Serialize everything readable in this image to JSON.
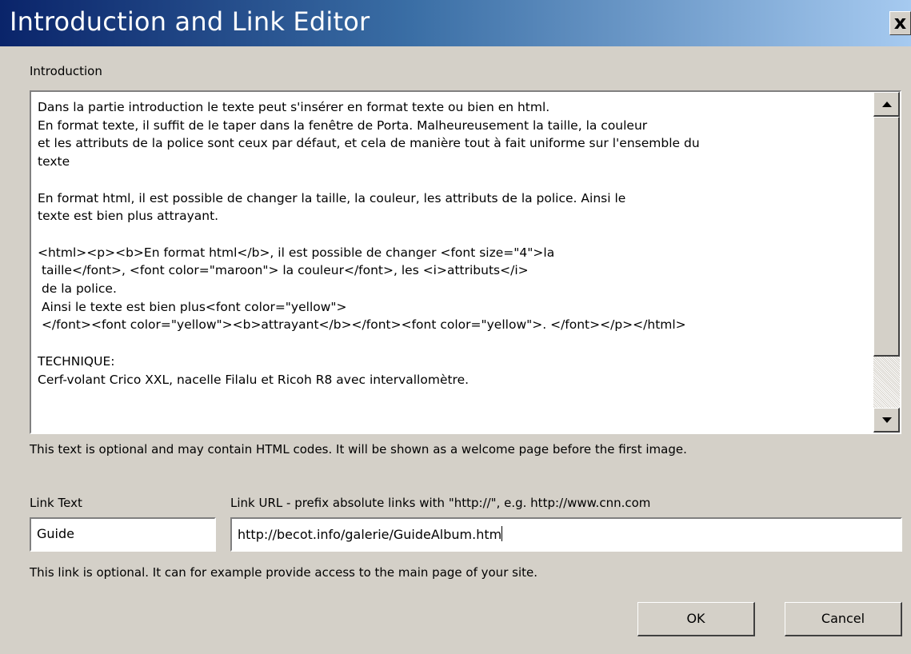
{
  "window": {
    "title": "Introduction and Link Editor",
    "close_label": "x"
  },
  "introduction": {
    "label": "Introduction",
    "text": "Dans la partie introduction le texte peut s'insérer en format texte ou bien en html.\nEn format texte, il suffit de le taper dans la fenêtre de Porta. Malheureusement la taille, la couleur\net les attributs de la police sont ceux par défaut, et cela de manière tout à fait uniforme sur l'ensemble du\ntexte\n\nEn format html, il est possible de changer la taille, la couleur, les attributs de la police. Ainsi le\ntexte est bien plus attrayant.\n\n<html><p><b>En format html</b>, il est possible de changer <font size=\"4\">la\n taille</font>, <font color=\"maroon\"> la couleur</font>, les <i>attributs</i>\n de la police.\n Ainsi le texte est bien plus<font color=\"yellow\">\n </font><font color=\"yellow\"><b>attrayant</b></font><font color=\"yellow\">. </font></p></html>\n\nTECHNIQUE:\nCerf-volant Crico XXL, nacelle Filalu et Ricoh R8 avec intervallomètre.",
    "hint": "This text is optional and may contain HTML codes. It will be shown as a welcome page before the first image."
  },
  "link": {
    "text_label": "Link Text",
    "url_label": "Link URL  -  prefix absolute links with \"http://\", e.g. http://www.cnn.com",
    "text_value": "Guide",
    "url_value": "http://becot.info/galerie/GuideAlbum.htm",
    "hint": "This link is optional. It can for example provide access to the main page of your site."
  },
  "buttons": {
    "ok": "OK",
    "cancel": "Cancel"
  }
}
